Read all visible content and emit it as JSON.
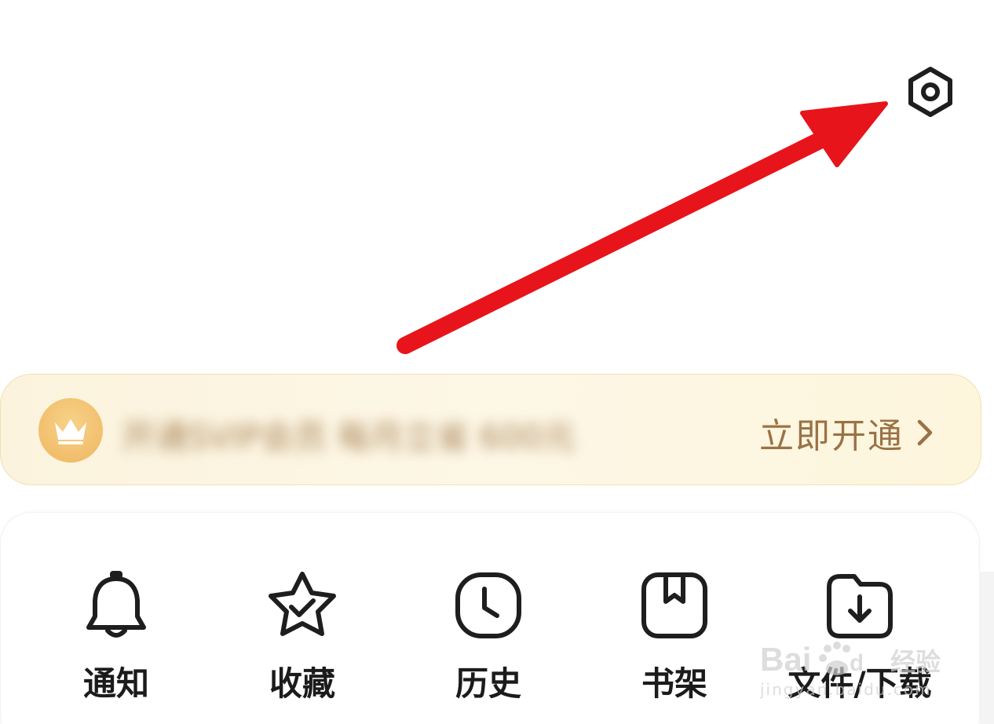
{
  "header": {
    "settings_icon": "gear-icon"
  },
  "vip_banner": {
    "icon": "crown-icon",
    "text": "开通SVIP会员 每月立省 600元",
    "cta_label": "立即开通",
    "cta_icon": "chevron-right-icon"
  },
  "menu": {
    "items": [
      {
        "label": "通知",
        "icon": "bell-icon"
      },
      {
        "label": "收藏",
        "icon": "star-check-icon"
      },
      {
        "label": "历史",
        "icon": "clock-icon"
      },
      {
        "label": "书架",
        "icon": "bookmark-icon"
      },
      {
        "label": "文件/下载",
        "icon": "download-folder-icon"
      }
    ]
  },
  "watermark": {
    "brand": "经验",
    "url": "jingyan.baidu.com"
  },
  "colors": {
    "annotation_arrow": "#e8141b",
    "vip_gold": "#9a7246",
    "banner_bg": "#fcf4df"
  }
}
